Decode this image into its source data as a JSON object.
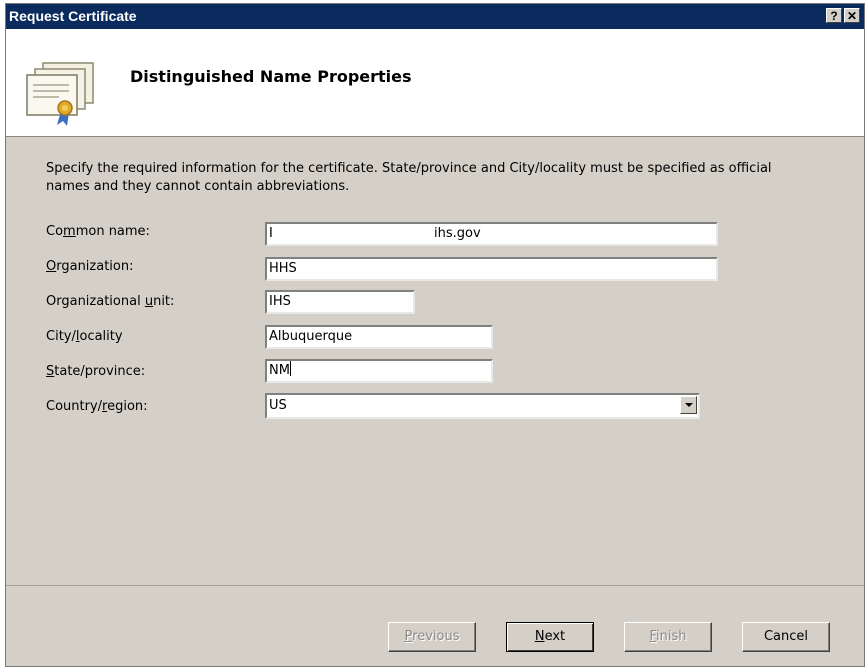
{
  "window": {
    "title": "Request Certificate",
    "help_button": "?",
    "close_button": "✕"
  },
  "header": {
    "heading": "Distinguished Name Properties",
    "icon": "certificate-icon"
  },
  "description": "Specify the required information for the certificate. State/province and City/locality must be specified as official names and they cannot contain abbreviations.",
  "fields": {
    "common_name": {
      "label_before": "Co",
      "label_accel": "m",
      "label_after": "mon name:",
      "value": "I                                       ihs.gov"
    },
    "organization": {
      "label_before": "",
      "label_accel": "O",
      "label_after": "rganization:",
      "value": "HHS"
    },
    "org_unit": {
      "label_before": "Organizational ",
      "label_accel": "u",
      "label_after": "nit:",
      "value": "IHS"
    },
    "city": {
      "label_before": "City/",
      "label_accel": "l",
      "label_after": "ocality",
      "value": "Albuquerque"
    },
    "state": {
      "label_before": "",
      "label_accel": "S",
      "label_after": "tate/province:",
      "value": "NM"
    },
    "country": {
      "label_before": "Country/",
      "label_accel": "r",
      "label_after": "egion:",
      "value": "US"
    }
  },
  "buttons": {
    "previous": {
      "before": "",
      "accel": "P",
      "after": "revious"
    },
    "next": {
      "before": "",
      "accel": "N",
      "after": "ext"
    },
    "finish": {
      "before": "",
      "accel": "F",
      "after": "inish"
    },
    "cancel": "Cancel"
  },
  "colors": {
    "titlebar": "#0b2a5d",
    "dialog": "#d4d0c8"
  }
}
